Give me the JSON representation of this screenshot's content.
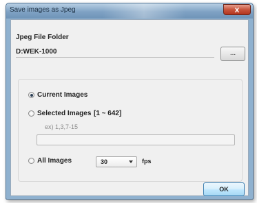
{
  "window": {
    "title": "Save images as Jpeg",
    "close_glyph": "x"
  },
  "folder": {
    "label": "Jpeg File Folder",
    "path": "D:WEK-1000",
    "browse_label": "..."
  },
  "options": {
    "current_images_label": "Current Images",
    "selected_images_label": "Selected Images",
    "selected_range": "[1 ~ 642]",
    "example_hint": "ex) 1,3,7-15",
    "range_value": "",
    "all_images_label": "All Images",
    "fps_value": "30",
    "fps_unit": "fps",
    "selected": "current_images"
  },
  "buttons": {
    "ok_label": "OK"
  }
}
